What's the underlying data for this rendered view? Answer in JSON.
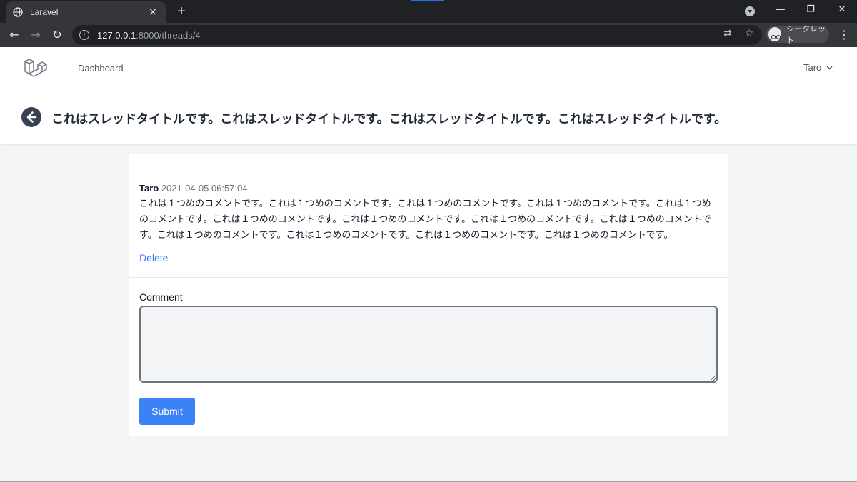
{
  "browser": {
    "tab_title": "Laravel",
    "tab_close": "×",
    "new_tab": "+",
    "url_host": "127.0.0.1",
    "url_path": ":8000/threads/4",
    "incognito_label": "シークレット",
    "minimize": "—",
    "restore": "❐",
    "close": "✕",
    "back": "←",
    "forward": "→",
    "reload": "↻",
    "info": "i",
    "translate": "⇄",
    "star": "☆",
    "menu": "⋮"
  },
  "nav": {
    "dashboard_label": "Dashboard",
    "user_name": "Taro",
    "user_chevron": "⌄"
  },
  "thread": {
    "title": "これはスレッドタイトルです。これはスレッドタイトルです。これはスレッドタイトルです。これはスレッドタイトルです。"
  },
  "comments": [
    {
      "author": "Taro",
      "timestamp": "2021-04-05 06:57:04",
      "body": "これは１つめのコメントです。これは１つめのコメントです。これは１つめのコメントです。これは１つめのコメントです。これは１つめのコメントです。これは１つめのコメントです。これは１つめのコメントです。これは１つめのコメントです。これは１つめのコメントです。これは１つめのコメントです。これは１つめのコメントです。これは１つめのコメントです。これは１つめのコメントです。",
      "delete_label": "Delete"
    }
  ],
  "form": {
    "label": "Comment",
    "value": "",
    "submit_label": "Submit"
  },
  "colors": {
    "accent": "#3b82f6",
    "chrome_dark": "#202124",
    "page_bg": "#f3f4f6"
  }
}
